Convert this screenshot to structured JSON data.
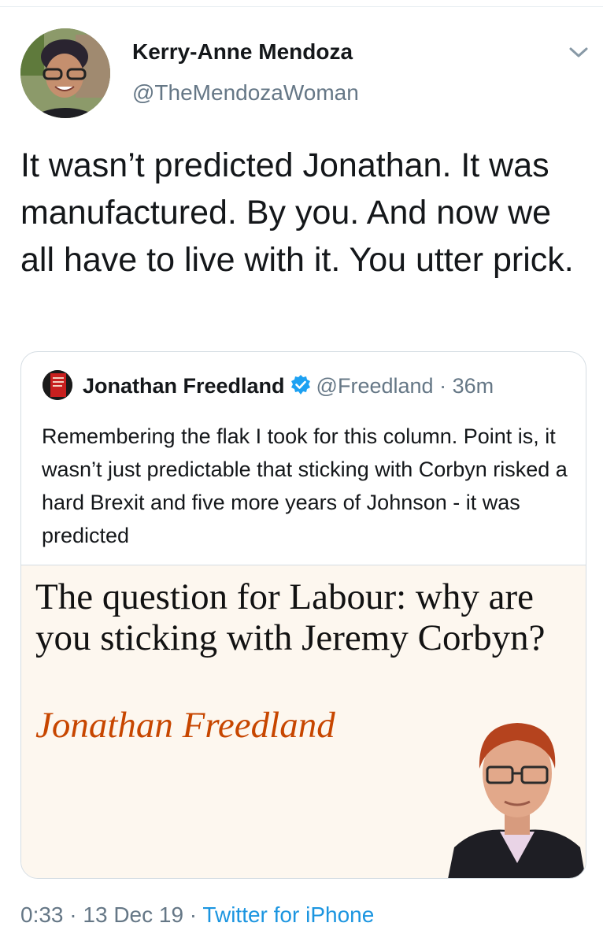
{
  "tweet": {
    "author_name": "Kerry-Anne Mendoza",
    "author_handle": "@TheMendozaWoman",
    "text": "It wasn’t predicted Jonathan. It was manufactured. By you. And now we all have to live with it. You utter prick."
  },
  "quoted_tweet": {
    "author_name": "Jonathan Freedland",
    "verified": true,
    "handle": "@Freedland",
    "separator": "·",
    "time": "36m",
    "text": "Remembering the flak I took for this column. Point is, it wasn’t just predictable that sticking with Corbyn risked a hard Brexit and five more years of Johnson - it was predicted",
    "media": {
      "headline": "The question for Labour: why are you sticking with Jeremy Corbyn?",
      "byline": "Jonathan Freedland",
      "byline_color": "#c74600",
      "background_color": "#fdf7ef"
    }
  },
  "meta": {
    "time": "0:33",
    "separator1": " · ",
    "date": "13 Dec 19",
    "separator2": " · ",
    "source": "Twitter for iPhone"
  },
  "colors": {
    "link": "#1b95e0",
    "secondary_text": "#657786",
    "verified_badge": "#1da1f2"
  }
}
